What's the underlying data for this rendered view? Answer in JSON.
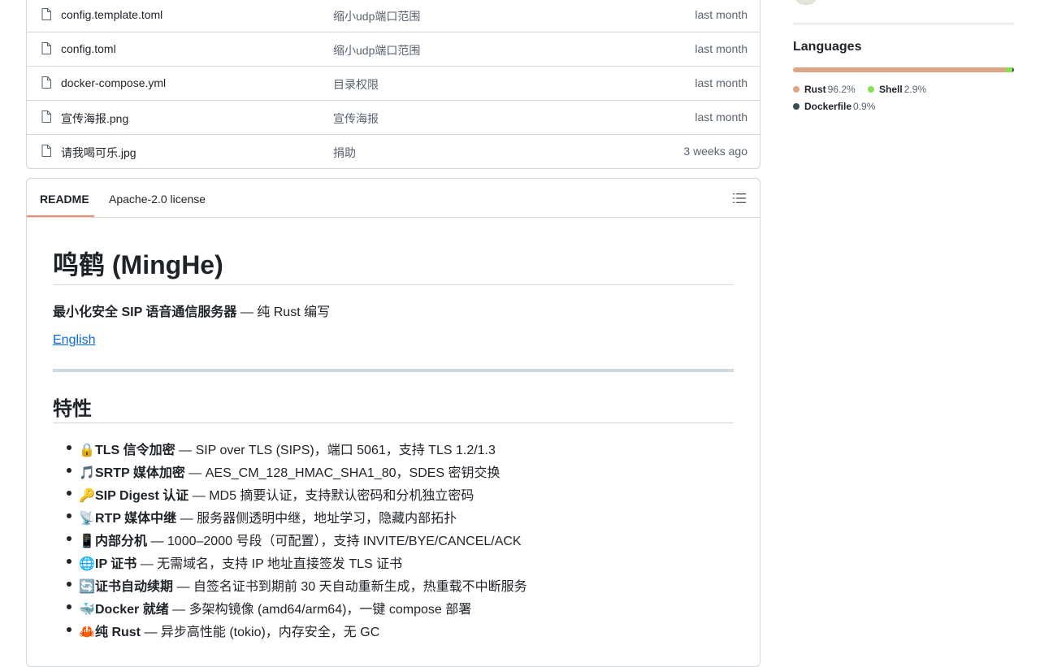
{
  "files": [
    {
      "name": "config.template.toml",
      "message": "缩小udp端口范围",
      "date": "last month"
    },
    {
      "name": "config.toml",
      "message": "缩小udp端口范围",
      "date": "last month"
    },
    {
      "name": "docker-compose.yml",
      "message": "目录权限",
      "date": "last month"
    },
    {
      "name": "宣传海报.png",
      "message": "宣传海报",
      "date": "last month"
    },
    {
      "name": "请我喝可乐.jpg",
      "message": "捐助",
      "date": "3 weeks ago"
    }
  ],
  "readme": {
    "tabs": {
      "readme": "README",
      "license": "Apache-2.0 license"
    },
    "title": "鸣鹤 (MingHe)",
    "tagline_bold": "最小化安全 SIP 语音通信服务器",
    "tagline_rest": " — 纯 Rust 编写",
    "english_link": "English",
    "features_heading": "特性",
    "features": [
      {
        "emoji": "🔒",
        "title": "TLS 信令加密",
        "desc": " — SIP over TLS (SIPS)，端口 5061，支持 TLS 1.2/1.3"
      },
      {
        "emoji": "🎵",
        "title": "SRTP 媒体加密",
        "desc": " — AES_CM_128_HMAC_SHA1_80，SDES 密钥交换"
      },
      {
        "emoji": "🔑",
        "title": "SIP Digest 认证",
        "desc": " — MD5 摘要认证，支持默认密码和分机独立密码"
      },
      {
        "emoji": "📡",
        "title": "RTP 媒体中继",
        "desc": " — 服务器侧透明中继，地址学习，隐藏内部拓扑"
      },
      {
        "emoji": "📱",
        "title": "内部分机",
        "desc": " — 1000–2000 号段（可配置），支持 INVITE/BYE/CANCEL/ACK"
      },
      {
        "emoji": "🌐",
        "title": "IP 证书",
        "desc": " — 无需域名，支持 IP 地址直接签发 TLS 证书"
      },
      {
        "emoji": "🔄",
        "title": "证书自动续期",
        "desc": " — 自签名证书到期前 30 天自动重新生成，热重载不中断服务"
      },
      {
        "emoji": "🐳",
        "title": "Docker 就绪",
        "desc": " — 多架构镜像 (amd64/arm64)，一键 compose 部署"
      },
      {
        "emoji": "🦀",
        "title": "纯 Rust",
        "desc": " — 异步高性能 (tokio)，内存安全，无 GC"
      }
    ]
  },
  "languages": {
    "title": "Languages",
    "items": [
      {
        "name": "Rust",
        "percent": "96.2%",
        "value": 96.2,
        "color": "#dea584"
      },
      {
        "name": "Shell",
        "percent": "2.9%",
        "value": 2.9,
        "color": "#89e051"
      },
      {
        "name": "Dockerfile",
        "percent": "0.9%",
        "value": 0.9,
        "color": "#384d54"
      }
    ]
  }
}
